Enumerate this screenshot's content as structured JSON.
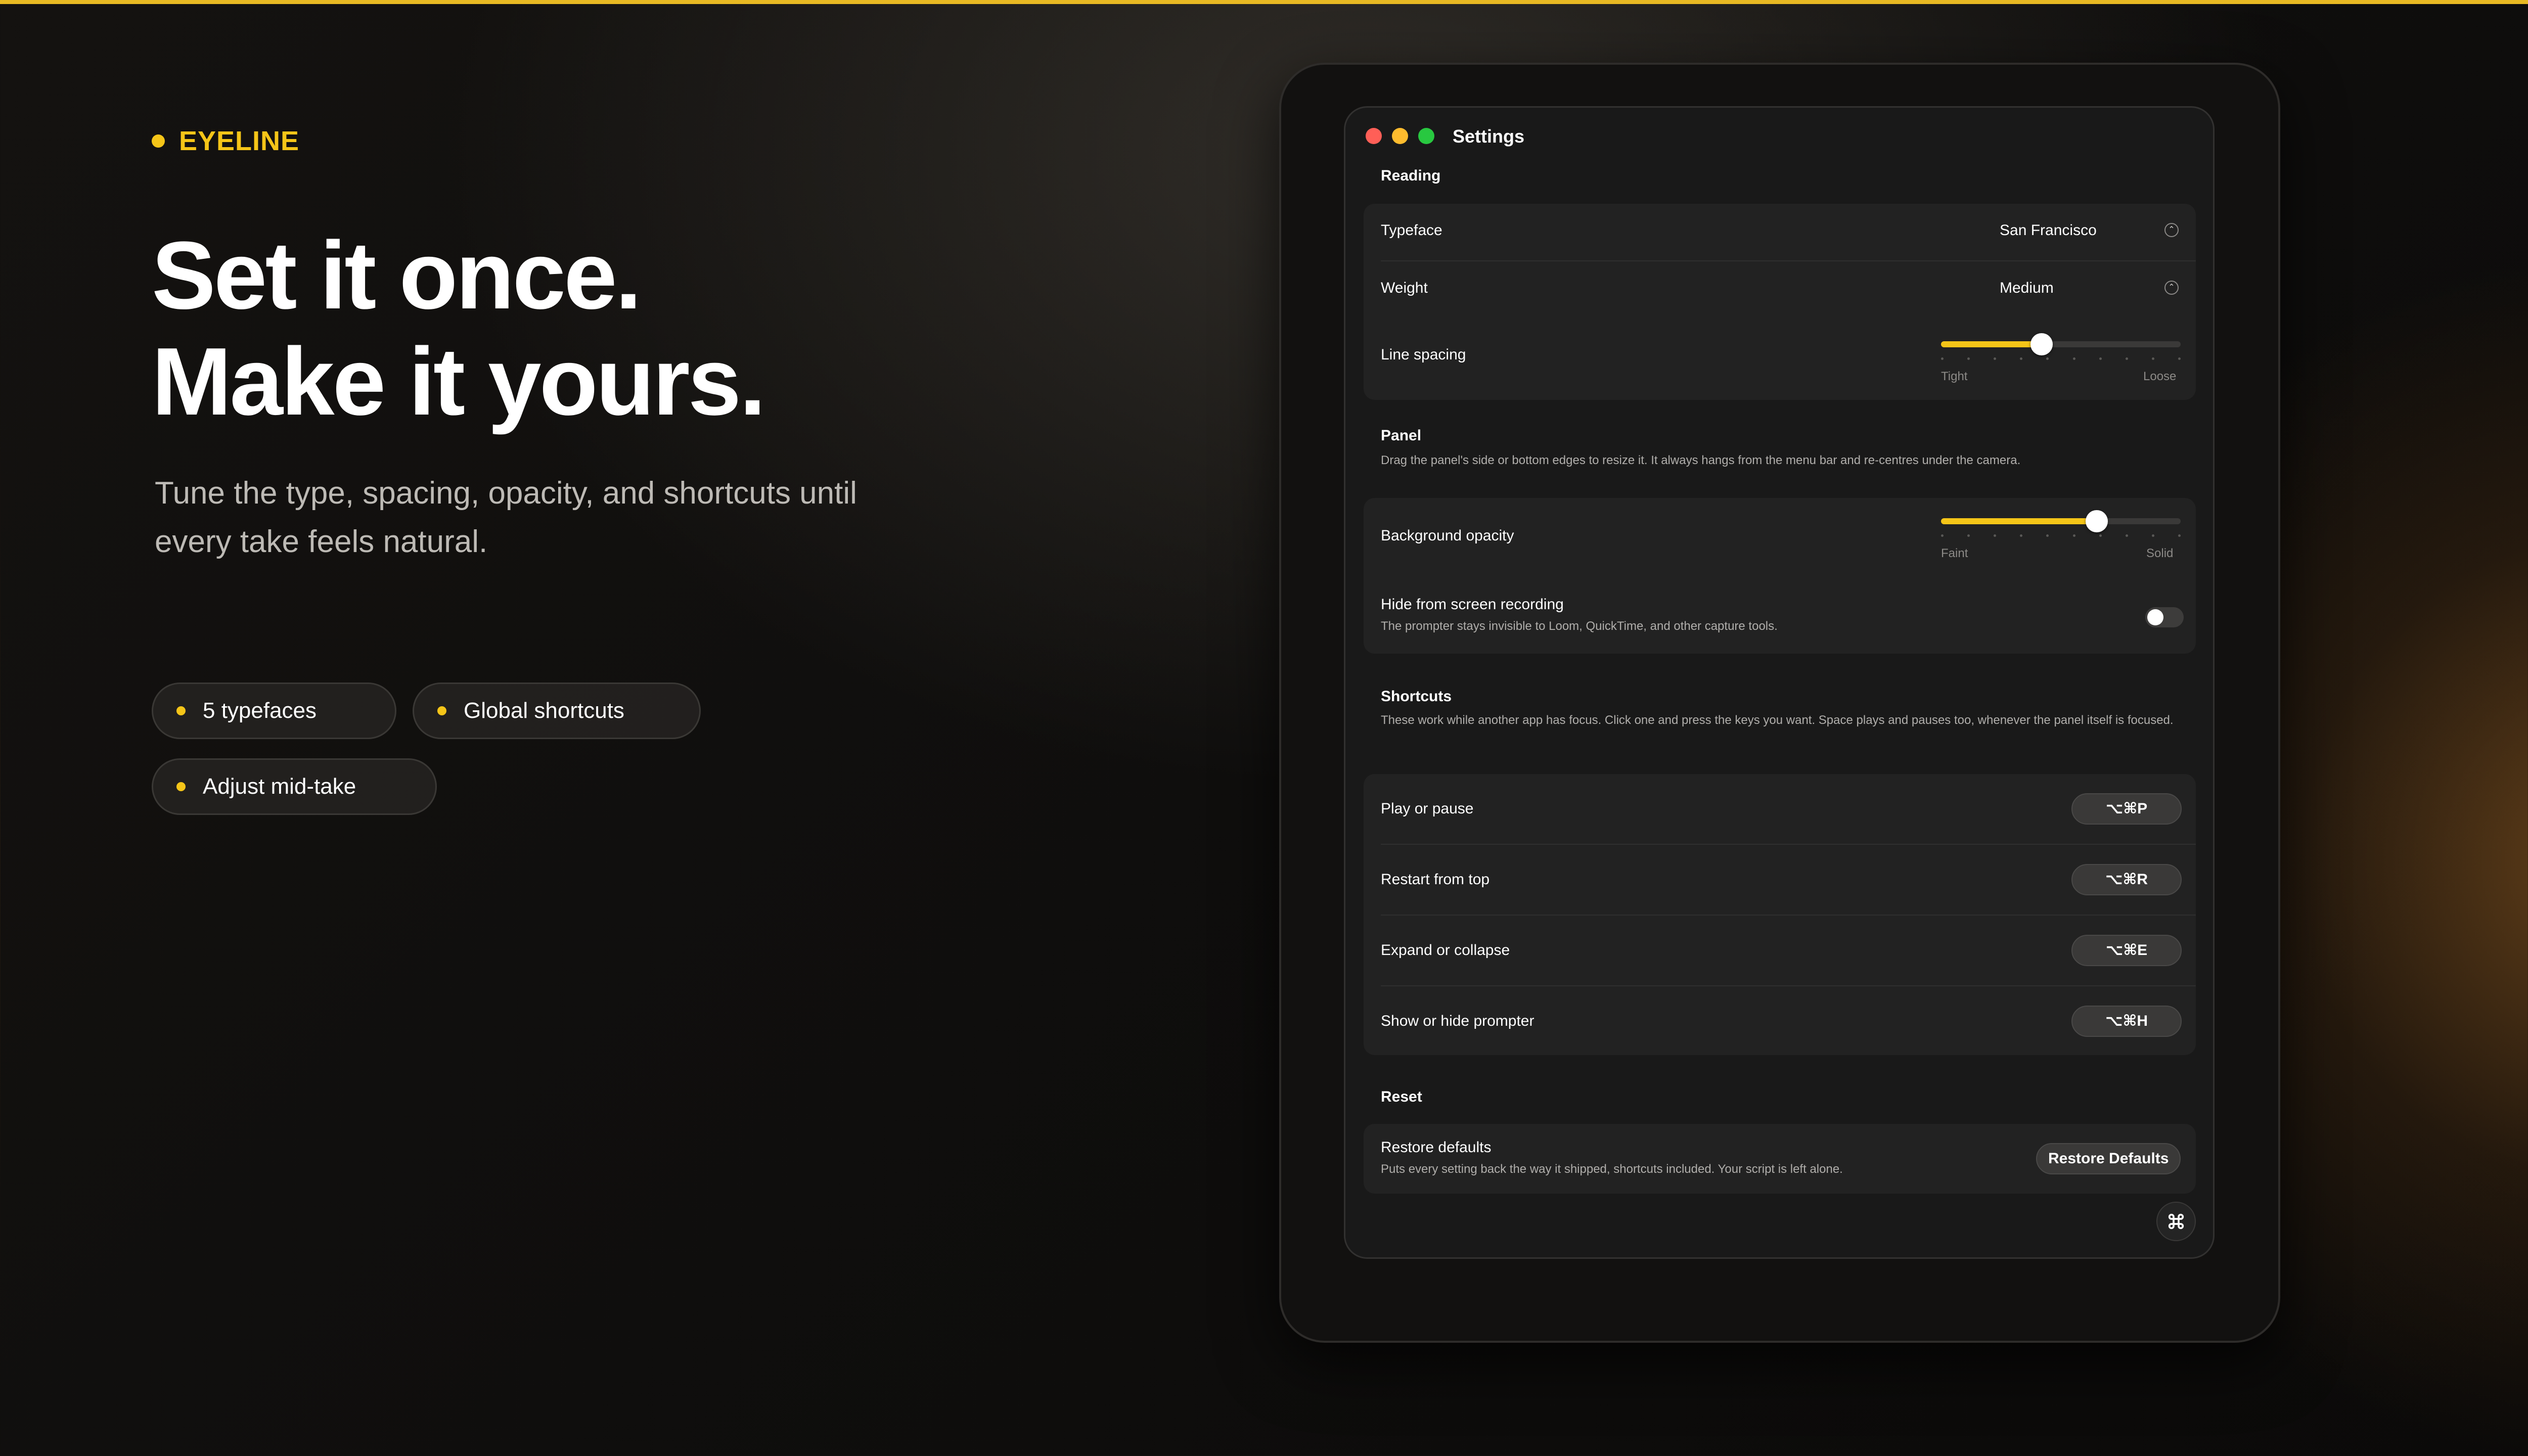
{
  "brand": {
    "name": "EYELINE",
    "accent": "#f5c518"
  },
  "hero": {
    "line1": "Set it once.",
    "line2": "Make it yours.",
    "subtitle": "Tune the type, spacing, opacity, and shortcuts until every take feels natural."
  },
  "chips": [
    "5 typefaces",
    "Global shortcuts",
    "Adjust mid-take"
  ],
  "window": {
    "title": "Settings",
    "reading": {
      "title": "Reading",
      "typeface_label": "Typeface",
      "typeface_value": "San Francisco",
      "weight_label": "Weight",
      "weight_value": "Medium",
      "line_spacing_label": "Line spacing",
      "line_spacing_value": 0.42,
      "line_spacing_min": "Tight",
      "line_spacing_max": "Loose"
    },
    "panel": {
      "title": "Panel",
      "description": "Drag the panel's side or bottom edges to resize it. It always hangs from the menu bar and re-centres under the camera.",
      "opacity_label": "Background opacity",
      "opacity_value": 0.65,
      "opacity_min": "Faint",
      "opacity_max": "Solid",
      "hide_label": "Hide from screen recording",
      "hide_desc": "The prompter stays invisible to Loom, QuickTime, and other capture tools.",
      "hide_enabled": false
    },
    "shortcuts": {
      "title": "Shortcuts",
      "description": "These work while another app has focus. Click one and press the keys you want. Space plays and pauses too, whenever the panel itself is focused.",
      "items": [
        {
          "label": "Play or pause",
          "keys": "⌥⌘P"
        },
        {
          "label": "Restart from top",
          "keys": "⌥⌘R"
        },
        {
          "label": "Expand or collapse",
          "keys": "⌥⌘E"
        },
        {
          "label": "Show or hide prompter",
          "keys": "⌥⌘H"
        }
      ]
    },
    "reset": {
      "title": "Reset",
      "label": "Restore defaults",
      "desc": "Puts every setting back the way it shipped, shortcuts included. Your script is left alone.",
      "button": "Restore Defaults"
    }
  }
}
